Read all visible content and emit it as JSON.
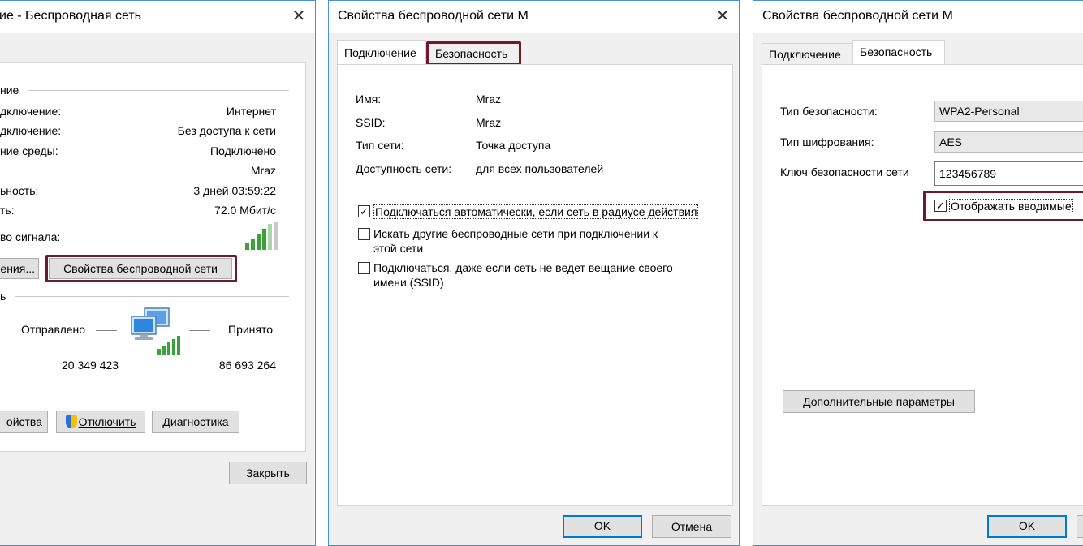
{
  "status_window": {
    "title": "ие - Беспроводная сеть",
    "group_connection": "ние",
    "rows": [
      {
        "label": "дключение:",
        "value": "Интернет"
      },
      {
        "label": "дключение:",
        "value": "Без доступа к сети"
      },
      {
        "label": "ние среды:",
        "value": "Подключено"
      },
      {
        "label": "",
        "value": "Mraz"
      },
      {
        "label": "ьность:",
        "value": "3 дней 03:59:22"
      },
      {
        "label": "ть:",
        "value": "72.0 Мбит/с"
      }
    ],
    "signal_label": "во сигнала:",
    "details_button": "ения...",
    "wireless_props_button": "Свойства беспроводной сети",
    "group_activity": "ь",
    "sent_label": "Отправлено",
    "received_label": "Принято",
    "sent_value": "20 349 423",
    "received_value": "86 693 264",
    "properties_button": "ойства",
    "disable_button": "Отключить",
    "diagnose_button": "Диагностика",
    "close_button": "Закрыть"
  },
  "props_connection_window": {
    "title": "Свойства беспроводной сети M",
    "tabs": [
      "Подключение",
      "Безопасность"
    ],
    "fields": [
      {
        "label": "Имя:",
        "value": "Mraz"
      },
      {
        "label": "SSID:",
        "value": "Mraz"
      },
      {
        "label": "Тип сети:",
        "value": "Точка доступа"
      },
      {
        "label": "Доступность сети:",
        "value": "для всех пользователей"
      }
    ],
    "checkboxes": [
      {
        "line1": "Подключаться автоматически, если сеть в радиусе действия",
        "line2": "",
        "checked": true
      },
      {
        "line1": "Искать другие беспроводные сети при подключении к",
        "line2": "этой сети",
        "checked": false
      },
      {
        "line1": "Подключаться, даже если сеть не ведет вещание своего",
        "line2": "имени (SSID)",
        "checked": false
      }
    ],
    "ok_button": "OK",
    "cancel_button": "Отмена"
  },
  "props_security_window": {
    "title": "Свойства беспроводной сети M",
    "tabs": [
      "Подключение",
      "Безопасность"
    ],
    "security_type_label": "Тип безопасности:",
    "security_type_value": "WPA2-Personal",
    "encryption_type_label": "Тип шифрования:",
    "encryption_type_value": "AES",
    "key_label": "Ключ безопасности сети",
    "key_value": "123456789",
    "show_chars_label": "Отображать вводимые",
    "advanced_button": "Дополнительные параметры",
    "ok_button": "OK"
  },
  "colors": {
    "highlight": "#6e1a2c",
    "window_border": "#4a90d9",
    "default_button": "#0078d7",
    "signal_green": "#3aa23a"
  }
}
